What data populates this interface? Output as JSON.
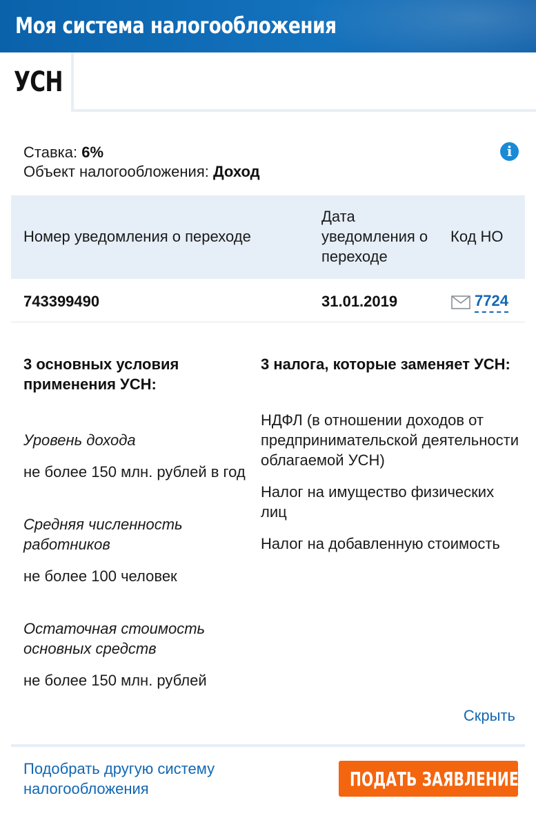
{
  "header": {
    "title": "Моя система налогообложения"
  },
  "tabs": {
    "active_label": "УСН"
  },
  "summary": {
    "rate_label": "Ставка:",
    "rate_value": "6%",
    "object_label": "Объект налогообложения:",
    "object_value": "Доход",
    "info_icon": "info-icon"
  },
  "table": {
    "headers": [
      "Номер уведомления о переходе",
      "Дата уведомления о переходе",
      "Код НО"
    ],
    "rows": [
      {
        "number": "743399490",
        "date": "31.01.2019",
        "code": "7724",
        "code_icon": "mail-icon"
      }
    ]
  },
  "conditions": {
    "title": "3 основных условия применения УСН:",
    "items": [
      {
        "label": "Уровень дохода",
        "value": "не более 150 млн. рублей в год"
      },
      {
        "label": "Средняя численность работников",
        "value": "не более 100 человек"
      },
      {
        "label": "Остаточная стоимость основных средств",
        "value": "не более 150 млн. рублей"
      }
    ]
  },
  "replaced_taxes": {
    "title": "3 налога, которые заменяет УСН:",
    "items": [
      "НДФЛ (в отношении доходов от предпринимательской деятельности облагаемой УСН)",
      "Налог на имущество физических лиц",
      "Налог на добавленную стоимость"
    ]
  },
  "actions": {
    "hide_label": "Скрыть",
    "choose_other_label": "Подобрать другую систему налогообложения",
    "apply_label": "ПОДАТЬ ЗАЯВЛЕНИЕ"
  },
  "colors": {
    "header": "#1472bd",
    "link": "#1267b3",
    "accent": "#f4650f",
    "table_head": "#e6eef7"
  }
}
